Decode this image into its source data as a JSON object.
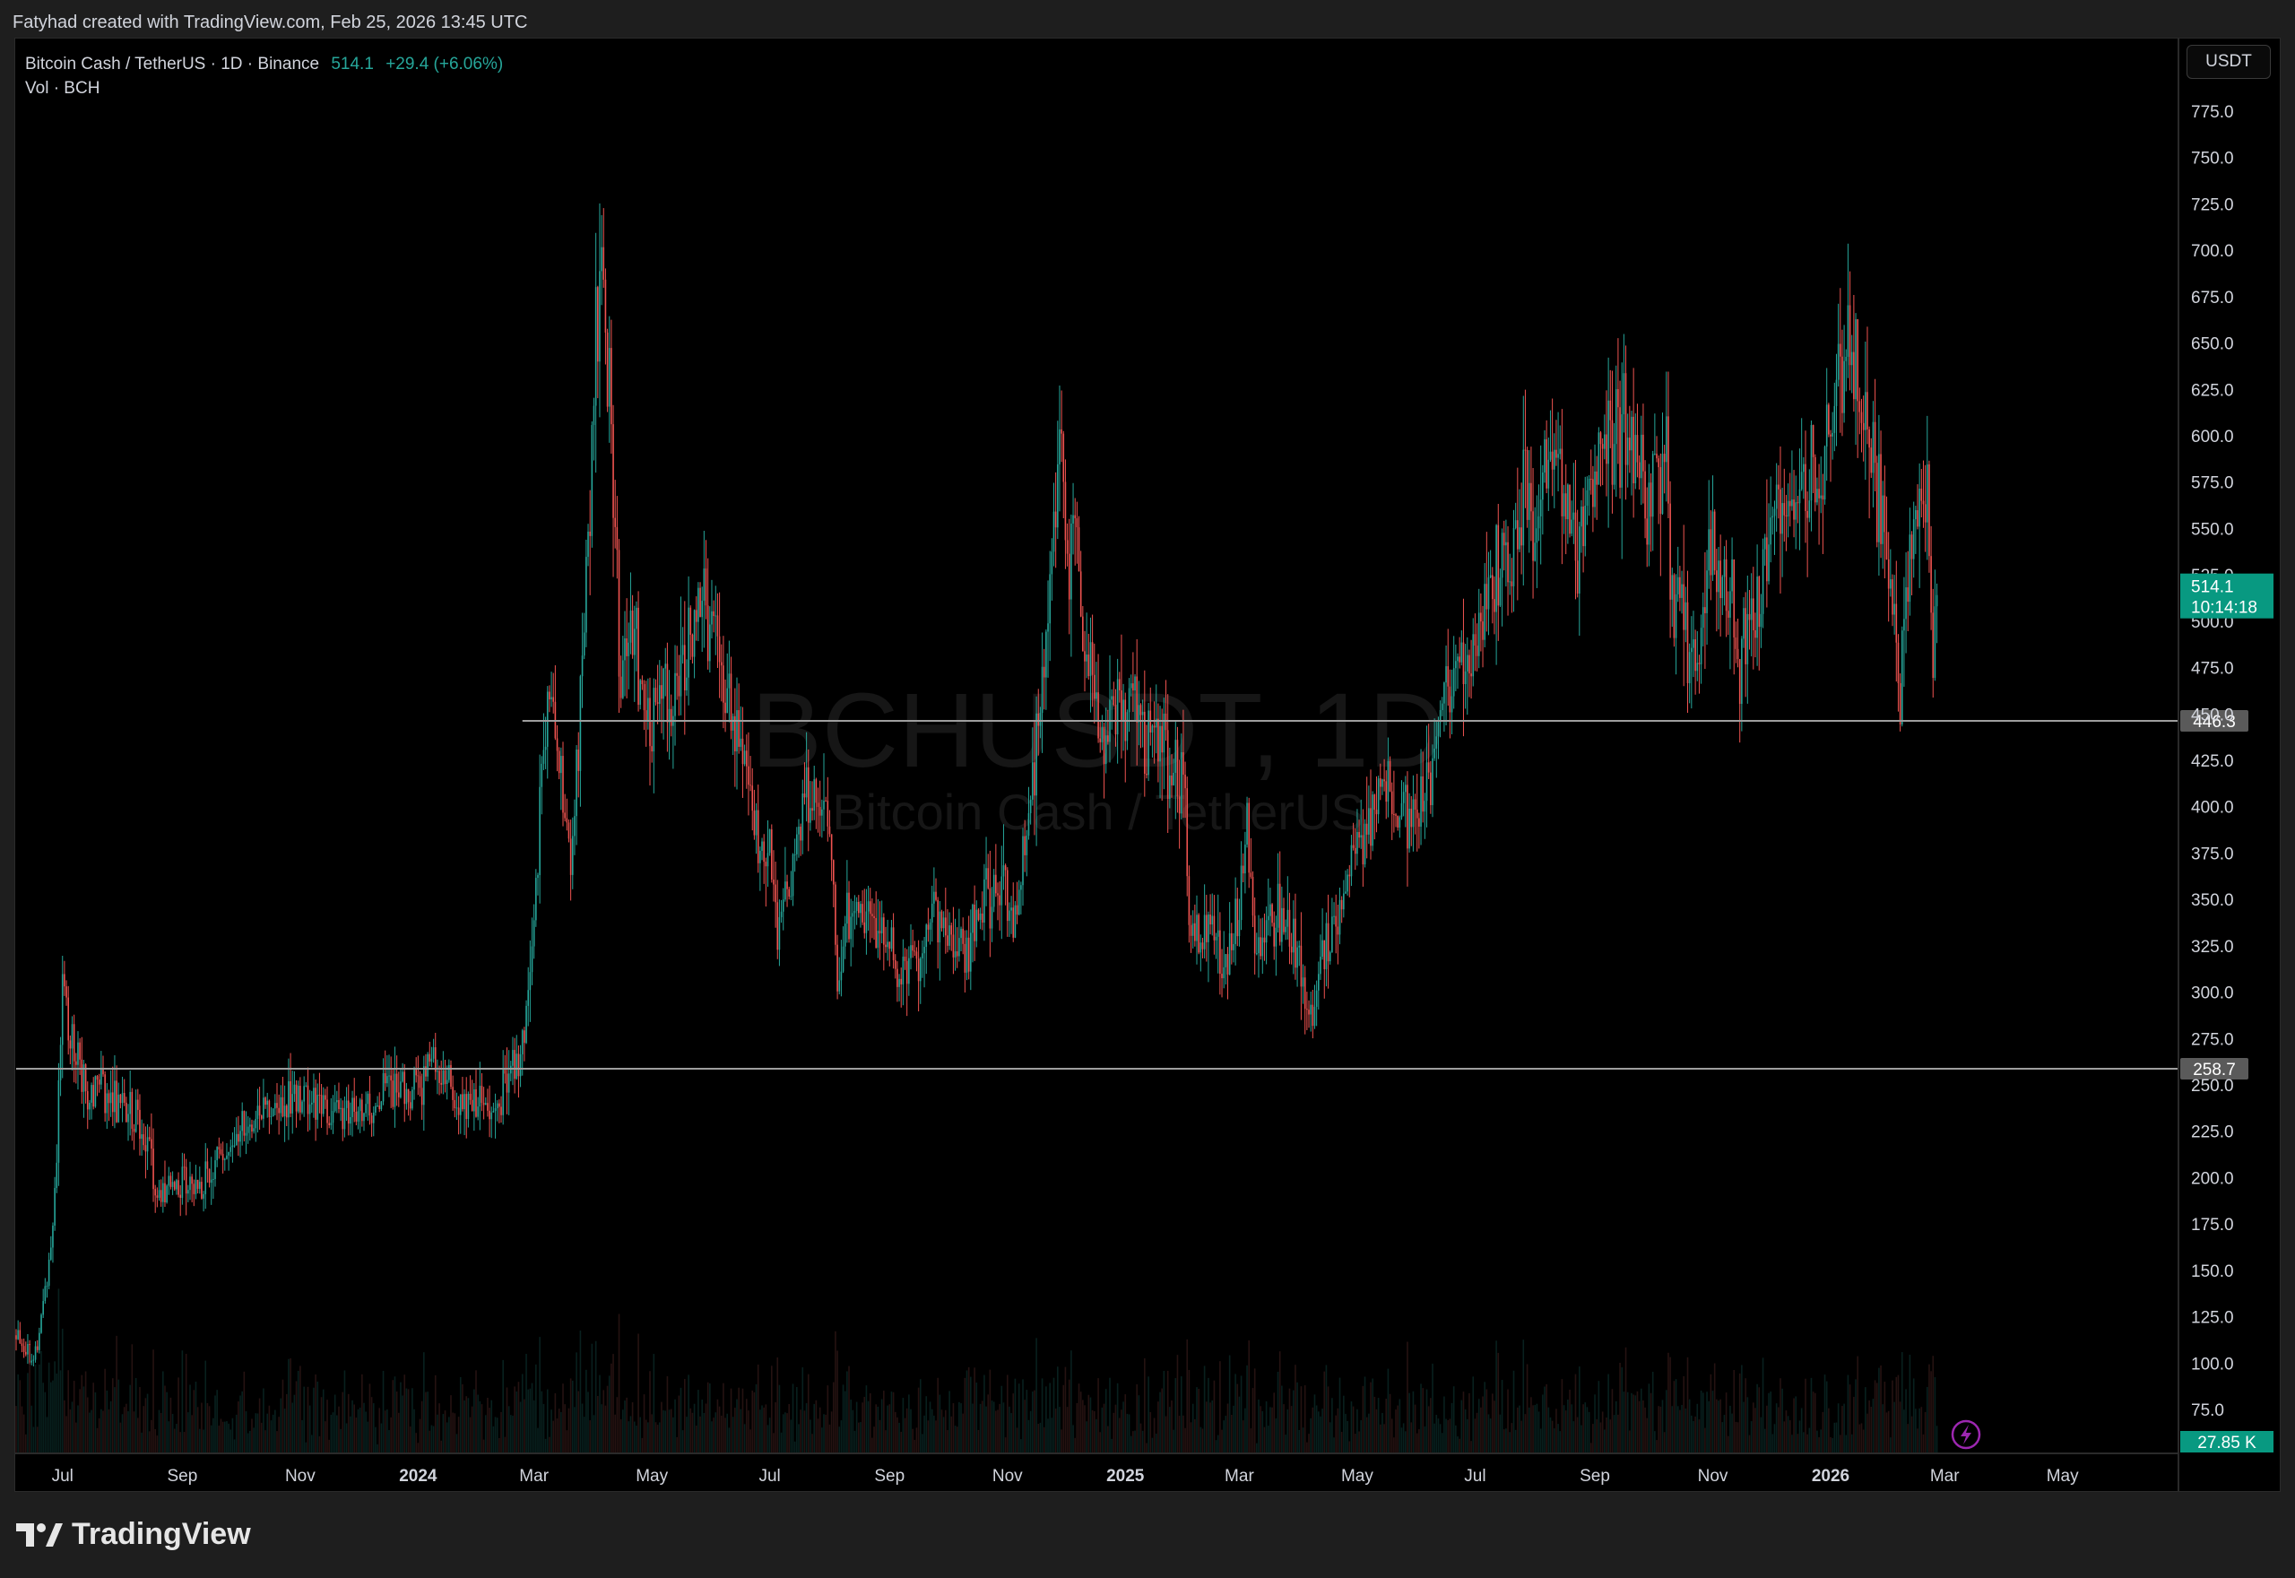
{
  "header": {
    "attribution": "Fatyhad created with TradingView.com, Feb 25, 2026 13:45 UTC"
  },
  "legend": {
    "symbol_line": "Bitcoin Cash / TetherUS · 1D · Binance",
    "last_price": "514.1",
    "change": "+29.4 (+6.06%)",
    "volume_line": "Vol · BCH"
  },
  "watermark": {
    "symbol": "BCHUSDT, 1D",
    "name": "Bitcoin Cash / TetherUS"
  },
  "price_scale": {
    "unit": "USDT",
    "current_price_label": "514.1",
    "countdown_label": "10:14:18",
    "volume_label": "27.85 K",
    "line_labels": [
      "446.3",
      "258.7"
    ]
  },
  "footer": {
    "brand": "TradingView"
  },
  "colors": {
    "up": "#26a69a",
    "down": "#ef5350",
    "background": "#000000",
    "frame": "#1e1e1e",
    "line": "#9e9e9e",
    "current_badge": "#089981"
  },
  "icons": {
    "replay": "lightning-bolt-icon",
    "logo": "tradingview-logo-icon"
  },
  "chart_data": {
    "type": "candlestick",
    "title": "",
    "xlabel": "",
    "ylabel": "",
    "ylim": [
      60,
      790
    ],
    "y_ticks": [
      "75.0",
      "100.0",
      "125.0",
      "150.0",
      "175.0",
      "200.0",
      "225.0",
      "250.0",
      "275.0",
      "300.0",
      "325.0",
      "350.0",
      "375.0",
      "400.0",
      "425.0",
      "450.0",
      "475.0",
      "500.0",
      "525.0",
      "550.0",
      "575.0",
      "600.0",
      "625.0",
      "650.0",
      "675.0",
      "700.0",
      "725.0",
      "750.0",
      "775.0"
    ],
    "x_ticks": [
      {
        "label": "Jul",
        "date": "2023-07-01",
        "bold": false
      },
      {
        "label": "Sep",
        "date": "2023-09-01",
        "bold": false
      },
      {
        "label": "Nov",
        "date": "2023-11-01",
        "bold": false
      },
      {
        "label": "2024",
        "date": "2024-01-01",
        "bold": true
      },
      {
        "label": "Mar",
        "date": "2024-03-01",
        "bold": false
      },
      {
        "label": "May",
        "date": "2024-05-01",
        "bold": false
      },
      {
        "label": "Jul",
        "date": "2024-07-01",
        "bold": false
      },
      {
        "label": "Sep",
        "date": "2024-09-01",
        "bold": false
      },
      {
        "label": "Nov",
        "date": "2024-11-01",
        "bold": false
      },
      {
        "label": "2025",
        "date": "2025-01-01",
        "bold": true
      },
      {
        "label": "Mar",
        "date": "2025-03-01",
        "bold": false
      },
      {
        "label": "May",
        "date": "2025-05-01",
        "bold": false
      },
      {
        "label": "Jul",
        "date": "2025-07-01",
        "bold": false
      },
      {
        "label": "Sep",
        "date": "2025-09-01",
        "bold": false
      },
      {
        "label": "Nov",
        "date": "2025-11-01",
        "bold": false
      },
      {
        "label": "2026",
        "date": "2026-01-01",
        "bold": true
      },
      {
        "label": "Mar",
        "date": "2026-03-01",
        "bold": false
      },
      {
        "label": "May",
        "date": "2026-05-01",
        "bold": false
      }
    ],
    "x_range": [
      "2023-06-07",
      "2026-06-30"
    ],
    "horizontal_lines": [
      {
        "price": 446.3,
        "start": "2024-02-24"
      },
      {
        "price": 258.7,
        "start": "2023-06-07"
      }
    ],
    "price_path": [
      [
        "2023-06-07",
        115
      ],
      [
        "2023-06-12",
        110
      ],
      [
        "2023-06-15",
        103
      ],
      [
        "2023-06-18",
        108
      ],
      [
        "2023-06-22",
        140
      ],
      [
        "2023-06-26",
        175
      ],
      [
        "2023-06-28",
        215
      ],
      [
        "2023-07-01",
        300
      ],
      [
        "2023-07-03",
        285
      ],
      [
        "2023-07-06",
        270
      ],
      [
        "2023-07-10",
        260
      ],
      [
        "2023-07-15",
        245
      ],
      [
        "2023-07-20",
        255
      ],
      [
        "2023-07-25",
        240
      ],
      [
        "2023-08-01",
        240
      ],
      [
        "2023-08-08",
        235
      ],
      [
        "2023-08-15",
        215
      ],
      [
        "2023-08-18",
        190
      ],
      [
        "2023-08-25",
        195
      ],
      [
        "2023-09-01",
        200
      ],
      [
        "2023-09-10",
        195
      ],
      [
        "2023-09-20",
        210
      ],
      [
        "2023-10-01",
        225
      ],
      [
        "2023-10-10",
        235
      ],
      [
        "2023-10-20",
        240
      ],
      [
        "2023-11-01",
        245
      ],
      [
        "2023-11-10",
        240
      ],
      [
        "2023-11-20",
        235
      ],
      [
        "2023-12-01",
        230
      ],
      [
        "2023-12-10",
        240
      ],
      [
        "2023-12-20",
        250
      ],
      [
        "2024-01-01",
        245
      ],
      [
        "2024-01-08",
        265
      ],
      [
        "2024-01-15",
        255
      ],
      [
        "2024-01-22",
        240
      ],
      [
        "2024-02-01",
        235
      ],
      [
        "2024-02-10",
        240
      ],
      [
        "2024-02-18",
        255
      ],
      [
        "2024-02-25",
        275
      ],
      [
        "2024-03-01",
        330
      ],
      [
        "2024-03-05",
        420
      ],
      [
        "2024-03-10",
        450
      ],
      [
        "2024-03-15",
        410
      ],
      [
        "2024-03-20",
        370
      ],
      [
        "2024-03-25",
        450
      ],
      [
        "2024-03-30",
        560
      ],
      [
        "2024-04-02",
        650
      ],
      [
        "2024-04-05",
        710
      ],
      [
        "2024-04-08",
        630
      ],
      [
        "2024-04-12",
        560
      ],
      [
        "2024-04-15",
        460
      ],
      [
        "2024-04-20",
        500
      ],
      [
        "2024-04-25",
        470
      ],
      [
        "2024-05-01",
        440
      ],
      [
        "2024-05-05",
        470
      ],
      [
        "2024-05-10",
        450
      ],
      [
        "2024-05-20",
        490
      ],
      [
        "2024-05-28",
        505
      ],
      [
        "2024-06-05",
        480
      ],
      [
        "2024-06-12",
        450
      ],
      [
        "2024-06-18",
        420
      ],
      [
        "2024-06-25",
        390
      ],
      [
        "2024-07-01",
        380
      ],
      [
        "2024-07-05",
        330
      ],
      [
        "2024-07-10",
        350
      ],
      [
        "2024-07-18",
        400
      ],
      [
        "2024-07-25",
        410
      ],
      [
        "2024-08-01",
        390
      ],
      [
        "2024-08-05",
        310
      ],
      [
        "2024-08-10",
        335
      ],
      [
        "2024-08-20",
        340
      ],
      [
        "2024-09-01",
        330
      ],
      [
        "2024-09-07",
        305
      ],
      [
        "2024-09-15",
        320
      ],
      [
        "2024-09-25",
        340
      ],
      [
        "2024-10-01",
        330
      ],
      [
        "2024-10-10",
        320
      ],
      [
        "2024-10-20",
        350
      ],
      [
        "2024-10-28",
        360
      ],
      [
        "2024-11-05",
        340
      ],
      [
        "2024-11-12",
        400
      ],
      [
        "2024-11-18",
        450
      ],
      [
        "2024-11-22",
        520
      ],
      [
        "2024-11-26",
        560
      ],
      [
        "2024-11-29",
        600
      ],
      [
        "2024-12-03",
        520
      ],
      [
        "2024-12-06",
        560
      ],
      [
        "2024-12-10",
        480
      ],
      [
        "2024-12-15",
        470
      ],
      [
        "2024-12-20",
        440
      ],
      [
        "2024-12-28",
        450
      ],
      [
        "2025-01-05",
        470
      ],
      [
        "2025-01-10",
        440
      ],
      [
        "2025-01-20",
        430
      ],
      [
        "2025-01-28",
        420
      ],
      [
        "2025-02-01",
        410
      ],
      [
        "2025-02-03",
        330
      ],
      [
        "2025-02-08",
        330
      ],
      [
        "2025-02-15",
        340
      ],
      [
        "2025-02-22",
        310
      ],
      [
        "2025-03-01",
        350
      ],
      [
        "2025-03-05",
        390
      ],
      [
        "2025-03-10",
        320
      ],
      [
        "2025-03-15",
        340
      ],
      [
        "2025-03-22",
        345
      ],
      [
        "2025-03-28",
        330
      ],
      [
        "2025-04-02",
        305
      ],
      [
        "2025-04-07",
        280
      ],
      [
        "2025-04-10",
        300
      ],
      [
        "2025-04-15",
        330
      ],
      [
        "2025-04-22",
        345
      ],
      [
        "2025-04-28",
        370
      ],
      [
        "2025-05-05",
        380
      ],
      [
        "2025-05-10",
        410
      ],
      [
        "2025-05-15",
        420
      ],
      [
        "2025-05-22",
        400
      ],
      [
        "2025-05-30",
        390
      ],
      [
        "2025-06-05",
        400
      ],
      [
        "2025-06-10",
        430
      ],
      [
        "2025-06-18",
        470
      ],
      [
        "2025-06-25",
        480
      ],
      [
        "2025-07-01",
        490
      ],
      [
        "2025-07-08",
        510
      ],
      [
        "2025-07-14",
        530
      ],
      [
        "2025-07-20",
        540
      ],
      [
        "2025-07-26",
        570
      ],
      [
        "2025-08-01",
        560
      ],
      [
        "2025-08-07",
        590
      ],
      [
        "2025-08-12",
        600
      ],
      [
        "2025-08-18",
        560
      ],
      [
        "2025-08-24",
        540
      ],
      [
        "2025-08-30",
        570
      ],
      [
        "2025-09-05",
        590
      ],
      [
        "2025-09-12",
        600
      ],
      [
        "2025-09-18",
        610
      ],
      [
        "2025-09-22",
        590
      ],
      [
        "2025-09-28",
        560
      ],
      [
        "2025-10-03",
        590
      ],
      [
        "2025-10-08",
        590
      ],
      [
        "2025-10-11",
        510
      ],
      [
        "2025-10-15",
        510
      ],
      [
        "2025-10-20",
        480
      ],
      [
        "2025-10-25",
        490
      ],
      [
        "2025-11-01",
        540
      ],
      [
        "2025-11-05",
        510
      ],
      [
        "2025-11-10",
        520
      ],
      [
        "2025-11-15",
        480
      ],
      [
        "2025-11-20",
        500
      ],
      [
        "2025-11-28",
        530
      ],
      [
        "2025-12-05",
        560
      ],
      [
        "2025-12-10",
        570
      ],
      [
        "2025-12-15",
        560
      ],
      [
        "2025-12-20",
        580
      ],
      [
        "2025-12-28",
        590
      ],
      [
        "2026-01-05",
        620
      ],
      [
        "2026-01-10",
        640
      ],
      [
        "2026-01-14",
        650
      ],
      [
        "2026-01-18",
        600
      ],
      [
        "2026-01-22",
        590
      ],
      [
        "2026-01-28",
        560
      ],
      [
        "2026-01-31",
        520
      ],
      [
        "2026-02-03",
        510
      ],
      [
        "2026-02-06",
        460
      ],
      [
        "2026-02-09",
        520
      ],
      [
        "2026-02-13",
        540
      ],
      [
        "2026-02-17",
        560
      ],
      [
        "2026-02-20",
        570
      ],
      [
        "2026-02-23",
        484
      ],
      [
        "2026-02-25",
        514.1
      ]
    ]
  }
}
